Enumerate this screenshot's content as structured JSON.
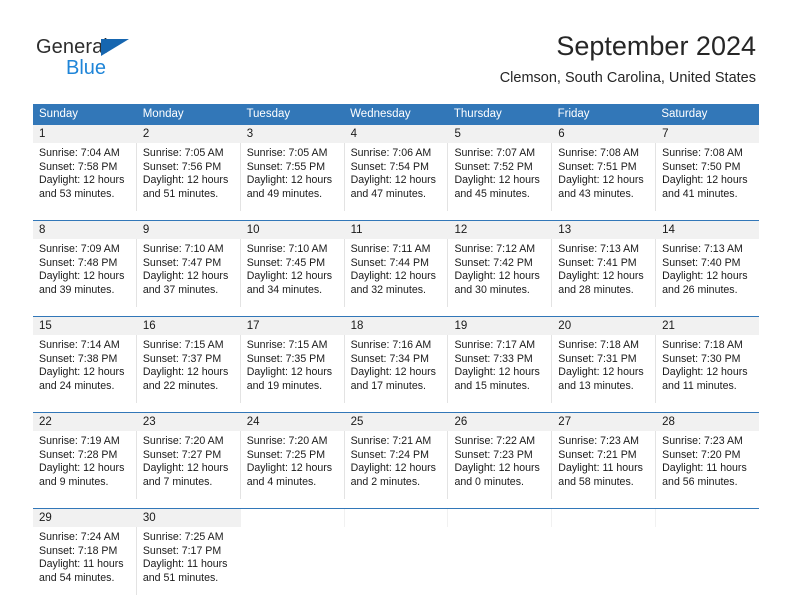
{
  "brand": {
    "name_top": "General",
    "name_bottom": "Blue",
    "accent_color": "#1f85d8",
    "triangle_color": "#1666b0"
  },
  "header": {
    "title": "September 2024",
    "location": "Clemson, South Carolina, United States"
  },
  "theme": {
    "header_row_bg": "#3277b8",
    "header_row_text": "#ffffff",
    "date_band_bg": "#f1f1f1",
    "week_rule": "#3277b8",
    "cell_divider": "#e3e3e3",
    "body_text": "#1a1a1a"
  },
  "weekdays": [
    "Sunday",
    "Monday",
    "Tuesday",
    "Wednesday",
    "Thursday",
    "Friday",
    "Saturday"
  ],
  "weeks": [
    {
      "days": [
        {
          "date": "1",
          "lines": [
            "Sunrise: 7:04 AM",
            "Sunset: 7:58 PM",
            "Daylight: 12 hours",
            "and 53 minutes."
          ]
        },
        {
          "date": "2",
          "lines": [
            "Sunrise: 7:05 AM",
            "Sunset: 7:56 PM",
            "Daylight: 12 hours",
            "and 51 minutes."
          ]
        },
        {
          "date": "3",
          "lines": [
            "Sunrise: 7:05 AM",
            "Sunset: 7:55 PM",
            "Daylight: 12 hours",
            "and 49 minutes."
          ]
        },
        {
          "date": "4",
          "lines": [
            "Sunrise: 7:06 AM",
            "Sunset: 7:54 PM",
            "Daylight: 12 hours",
            "and 47 minutes."
          ]
        },
        {
          "date": "5",
          "lines": [
            "Sunrise: 7:07 AM",
            "Sunset: 7:52 PM",
            "Daylight: 12 hours",
            "and 45 minutes."
          ]
        },
        {
          "date": "6",
          "lines": [
            "Sunrise: 7:08 AM",
            "Sunset: 7:51 PM",
            "Daylight: 12 hours",
            "and 43 minutes."
          ]
        },
        {
          "date": "7",
          "lines": [
            "Sunrise: 7:08 AM",
            "Sunset: 7:50 PM",
            "Daylight: 12 hours",
            "and 41 minutes."
          ]
        }
      ]
    },
    {
      "days": [
        {
          "date": "8",
          "lines": [
            "Sunrise: 7:09 AM",
            "Sunset: 7:48 PM",
            "Daylight: 12 hours",
            "and 39 minutes."
          ]
        },
        {
          "date": "9",
          "lines": [
            "Sunrise: 7:10 AM",
            "Sunset: 7:47 PM",
            "Daylight: 12 hours",
            "and 37 minutes."
          ]
        },
        {
          "date": "10",
          "lines": [
            "Sunrise: 7:10 AM",
            "Sunset: 7:45 PM",
            "Daylight: 12 hours",
            "and 34 minutes."
          ]
        },
        {
          "date": "11",
          "lines": [
            "Sunrise: 7:11 AM",
            "Sunset: 7:44 PM",
            "Daylight: 12 hours",
            "and 32 minutes."
          ]
        },
        {
          "date": "12",
          "lines": [
            "Sunrise: 7:12 AM",
            "Sunset: 7:42 PM",
            "Daylight: 12 hours",
            "and 30 minutes."
          ]
        },
        {
          "date": "13",
          "lines": [
            "Sunrise: 7:13 AM",
            "Sunset: 7:41 PM",
            "Daylight: 12 hours",
            "and 28 minutes."
          ]
        },
        {
          "date": "14",
          "lines": [
            "Sunrise: 7:13 AM",
            "Sunset: 7:40 PM",
            "Daylight: 12 hours",
            "and 26 minutes."
          ]
        }
      ]
    },
    {
      "days": [
        {
          "date": "15",
          "lines": [
            "Sunrise: 7:14 AM",
            "Sunset: 7:38 PM",
            "Daylight: 12 hours",
            "and 24 minutes."
          ]
        },
        {
          "date": "16",
          "lines": [
            "Sunrise: 7:15 AM",
            "Sunset: 7:37 PM",
            "Daylight: 12 hours",
            "and 22 minutes."
          ]
        },
        {
          "date": "17",
          "lines": [
            "Sunrise: 7:15 AM",
            "Sunset: 7:35 PM",
            "Daylight: 12 hours",
            "and 19 minutes."
          ]
        },
        {
          "date": "18",
          "lines": [
            "Sunrise: 7:16 AM",
            "Sunset: 7:34 PM",
            "Daylight: 12 hours",
            "and 17 minutes."
          ]
        },
        {
          "date": "19",
          "lines": [
            "Sunrise: 7:17 AM",
            "Sunset: 7:33 PM",
            "Daylight: 12 hours",
            "and 15 minutes."
          ]
        },
        {
          "date": "20",
          "lines": [
            "Sunrise: 7:18 AM",
            "Sunset: 7:31 PM",
            "Daylight: 12 hours",
            "and 13 minutes."
          ]
        },
        {
          "date": "21",
          "lines": [
            "Sunrise: 7:18 AM",
            "Sunset: 7:30 PM",
            "Daylight: 12 hours",
            "and 11 minutes."
          ]
        }
      ]
    },
    {
      "days": [
        {
          "date": "22",
          "lines": [
            "Sunrise: 7:19 AM",
            "Sunset: 7:28 PM",
            "Daylight: 12 hours",
            "and 9 minutes."
          ]
        },
        {
          "date": "23",
          "lines": [
            "Sunrise: 7:20 AM",
            "Sunset: 7:27 PM",
            "Daylight: 12 hours",
            "and 7 minutes."
          ]
        },
        {
          "date": "24",
          "lines": [
            "Sunrise: 7:20 AM",
            "Sunset: 7:25 PM",
            "Daylight: 12 hours",
            "and 4 minutes."
          ]
        },
        {
          "date": "25",
          "lines": [
            "Sunrise: 7:21 AM",
            "Sunset: 7:24 PM",
            "Daylight: 12 hours",
            "and 2 minutes."
          ]
        },
        {
          "date": "26",
          "lines": [
            "Sunrise: 7:22 AM",
            "Sunset: 7:23 PM",
            "Daylight: 12 hours",
            "and 0 minutes."
          ]
        },
        {
          "date": "27",
          "lines": [
            "Sunrise: 7:23 AM",
            "Sunset: 7:21 PM",
            "Daylight: 11 hours",
            "and 58 minutes."
          ]
        },
        {
          "date": "28",
          "lines": [
            "Sunrise: 7:23 AM",
            "Sunset: 7:20 PM",
            "Daylight: 11 hours",
            "and 56 minutes."
          ]
        }
      ]
    },
    {
      "days": [
        {
          "date": "29",
          "lines": [
            "Sunrise: 7:24 AM",
            "Sunset: 7:18 PM",
            "Daylight: 11 hours",
            "and 54 minutes."
          ]
        },
        {
          "date": "30",
          "lines": [
            "Sunrise: 7:25 AM",
            "Sunset: 7:17 PM",
            "Daylight: 11 hours",
            "and 51 minutes."
          ]
        },
        {
          "date": "",
          "lines": []
        },
        {
          "date": "",
          "lines": []
        },
        {
          "date": "",
          "lines": []
        },
        {
          "date": "",
          "lines": []
        },
        {
          "date": "",
          "lines": []
        }
      ]
    }
  ]
}
